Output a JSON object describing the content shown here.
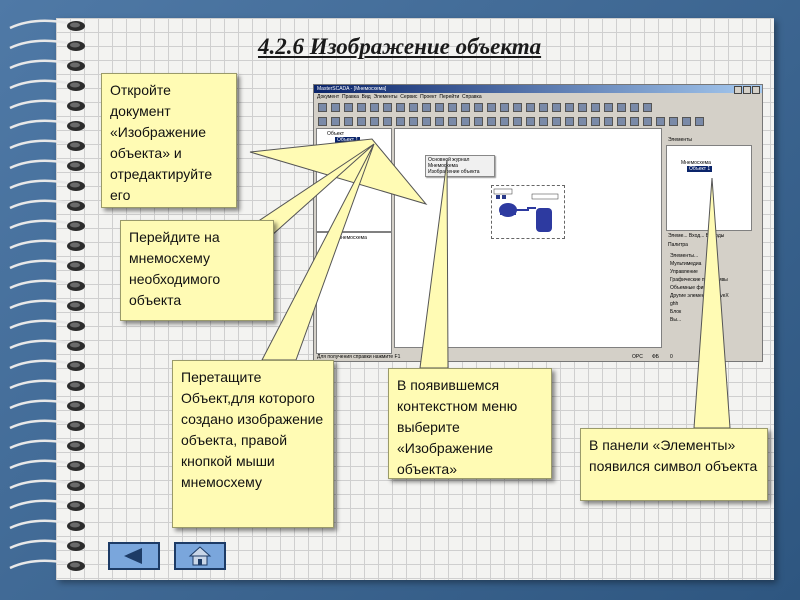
{
  "title": "4.2.6 Изображение объекта",
  "callouts": {
    "c1": "Откройте документ «Изображение объекта» и отредактируйте его",
    "c2": "Перейдите на мнемосхему необходимого объекта",
    "c3": "Перетащите Объект,для которого создано изображение объекта, правой кнопкой мыши мнемосхему",
    "c4": "В появившемся контекстном меню выберите «Изображение объекта»",
    "c5": "В панели «Элементы» появился символ объекта"
  },
  "screenshot": {
    "window_title": "MasterSCADA - [Мнемосхема]",
    "menu": [
      "Документ",
      "Правка",
      "Вид",
      "Элементы",
      "Сервис",
      "Проект",
      "Перейти",
      "Справка"
    ],
    "tree_root": "Объект",
    "tree_selected": "Объект 1",
    "tree_child": "Объект",
    "lower_panel_item": "Мнемосхема",
    "context_menu": [
      "Основной журнал",
      "Мнемосхема",
      "Изображение объекта"
    ],
    "elements_title": "Элементы",
    "elements_tree_item": "Мнемосхема",
    "elements_selected": "Объект 1",
    "palette_title": "Палитра",
    "palette_tabs": [
      "Элеме...",
      "Вход...",
      "Выходы"
    ],
    "palette_items": [
      "Элементы...",
      "Мультимедиа",
      "Управление",
      "Графические примитивы",
      "Объемные фигуры",
      "Другие элементы ActiveX",
      "ghh",
      "Блок",
      "Вы..."
    ],
    "status_text": "Для получения справки нажмите F1",
    "status_right": [
      "OPC",
      "ФБ",
      "0"
    ]
  },
  "nav": {
    "back_icon": "triangle-left-icon",
    "home_icon": "home-icon"
  }
}
